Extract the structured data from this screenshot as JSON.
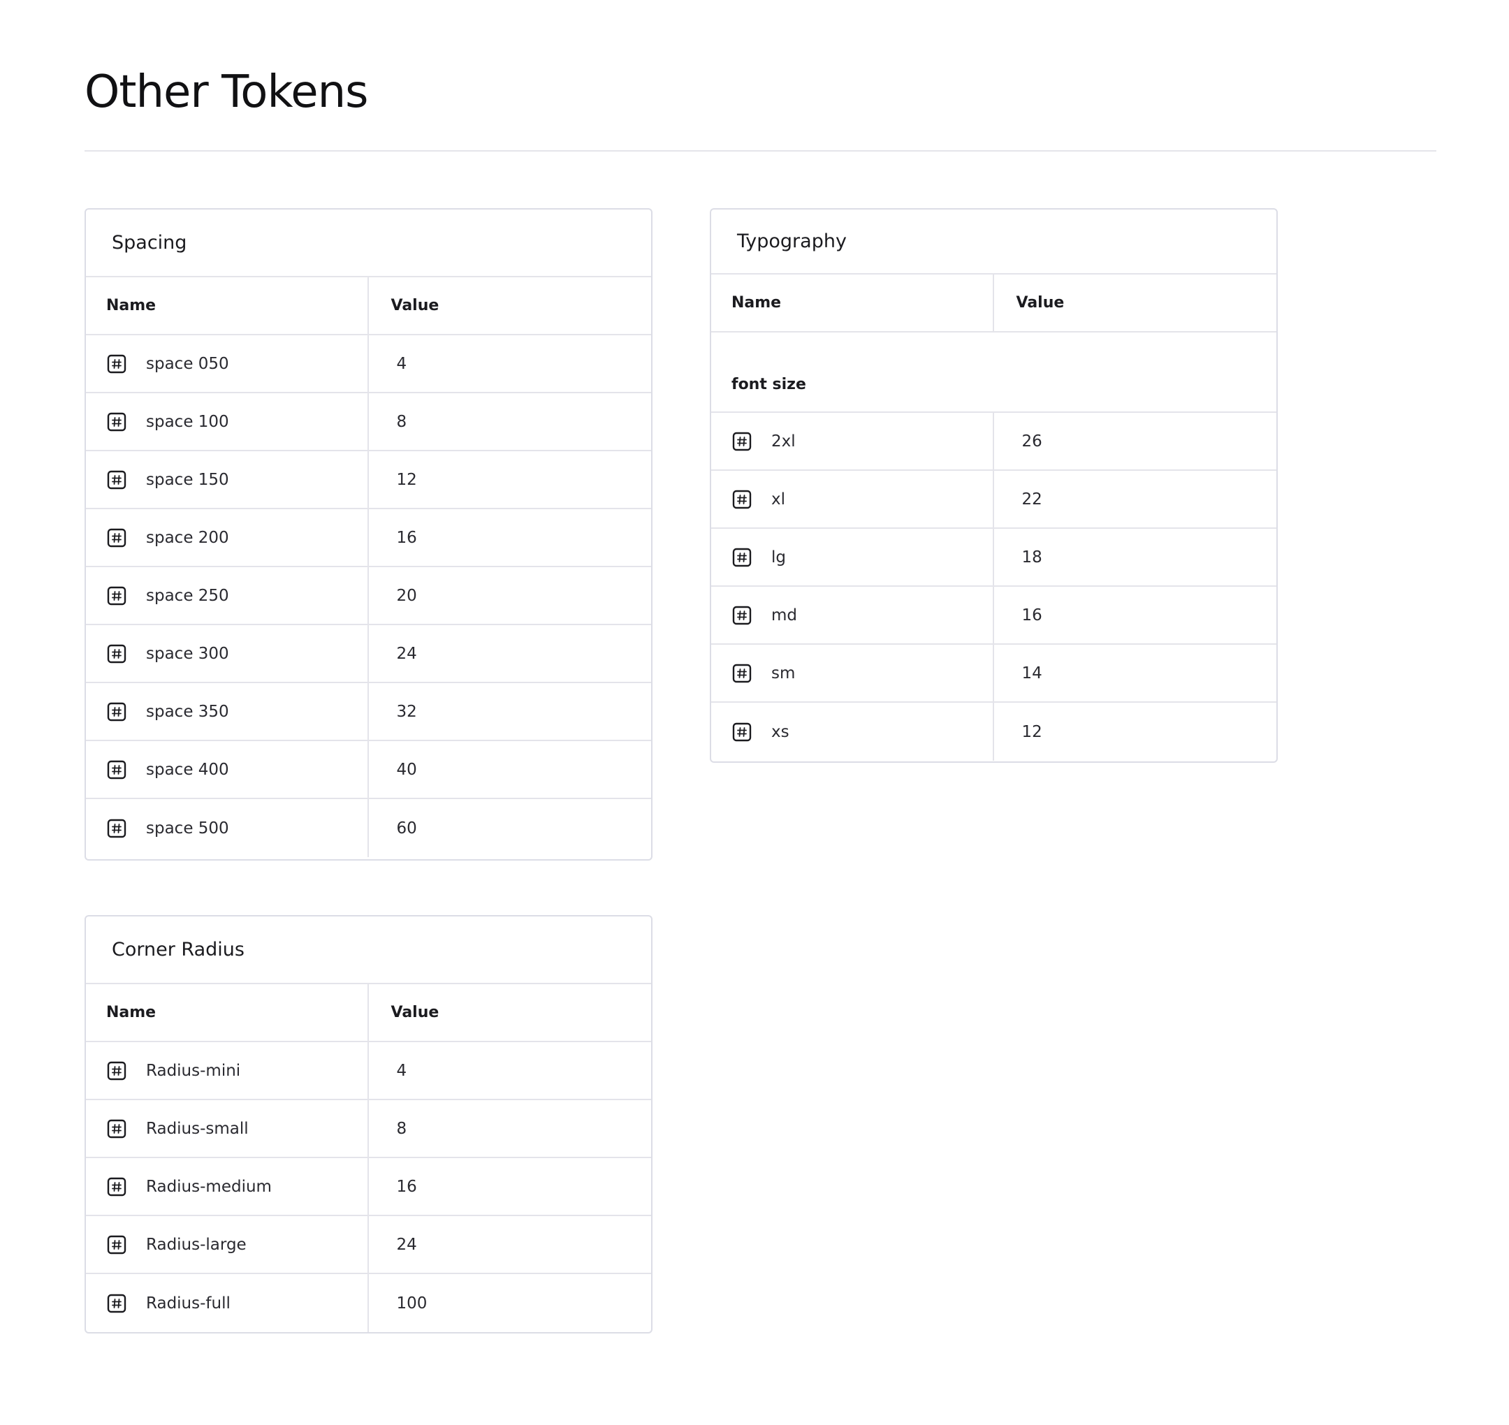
{
  "page": {
    "title": "Other Tokens"
  },
  "spacing": {
    "title": "Spacing",
    "columns": {
      "name": "Name",
      "value": "Value"
    },
    "rows": [
      {
        "name": "space 050",
        "value": "4"
      },
      {
        "name": "space 100",
        "value": "8"
      },
      {
        "name": "space 150",
        "value": "12"
      },
      {
        "name": "space 200",
        "value": "16"
      },
      {
        "name": "space 250",
        "value": "20"
      },
      {
        "name": "space 300",
        "value": "24"
      },
      {
        "name": "space 350",
        "value": "32"
      },
      {
        "name": "space 400",
        "value": "40"
      },
      {
        "name": "space 500",
        "value": "60"
      }
    ]
  },
  "typography": {
    "title": "Typography",
    "columns": {
      "name": "Name",
      "value": "Value"
    },
    "group_label": "font size",
    "rows": [
      {
        "name": "2xl",
        "value": "26"
      },
      {
        "name": "xl",
        "value": "22"
      },
      {
        "name": "lg",
        "value": "18"
      },
      {
        "name": "md",
        "value": "16"
      },
      {
        "name": "sm",
        "value": "14"
      },
      {
        "name": "xs",
        "value": "12"
      }
    ]
  },
  "corner_radius": {
    "title": "Corner Radius",
    "columns": {
      "name": "Name",
      "value": "Value"
    },
    "rows": [
      {
        "name": "Radius-mini",
        "value": "4"
      },
      {
        "name": "Radius-small",
        "value": "8"
      },
      {
        "name": "Radius-medium",
        "value": "16"
      },
      {
        "name": "Radius-large",
        "value": "24"
      },
      {
        "name": "Radius-full",
        "value": "100"
      }
    ]
  },
  "icons": {
    "token_type": "hash-icon"
  },
  "colors": {
    "border": "#dcdde6",
    "divider": "#e4e4ea",
    "text": "#1b1b1f"
  }
}
